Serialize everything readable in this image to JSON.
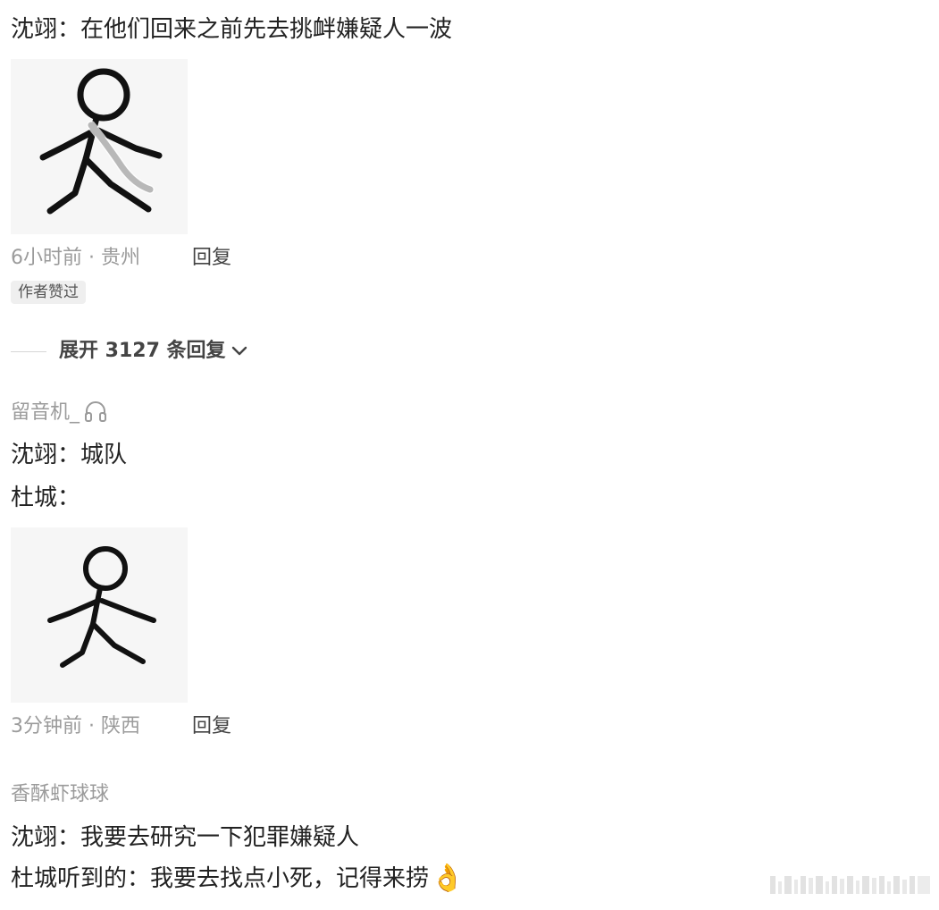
{
  "comment1": {
    "text": "沈翊：在他们回来之前先去挑衅嫌疑人一波",
    "sticker_icon": "running-stickman-with-sash-icon",
    "meta": "6小时前 · 贵州",
    "reply_label": "回复",
    "badge": "作者赞过",
    "expand_label": "展开 3127 条回复"
  },
  "comment2": {
    "username": "留音机_",
    "username_icon": "headphones-icon",
    "line1": "沈翊：城队",
    "line2": "杜城：",
    "sticker_icon": "running-stickman-icon",
    "meta": "3分钟前 · 陕西",
    "reply_label": "回复"
  },
  "comment3": {
    "username": "香酥虾球球",
    "line1": "沈翊：我要去研究一下犯罪嫌疑人",
    "line2": "杜城听到的：我要去找点小死，记得来捞",
    "emoji": "👌"
  },
  "colors": {
    "text": "#222222",
    "meta": "#9b9b9b",
    "badge_bg": "#efefef"
  }
}
